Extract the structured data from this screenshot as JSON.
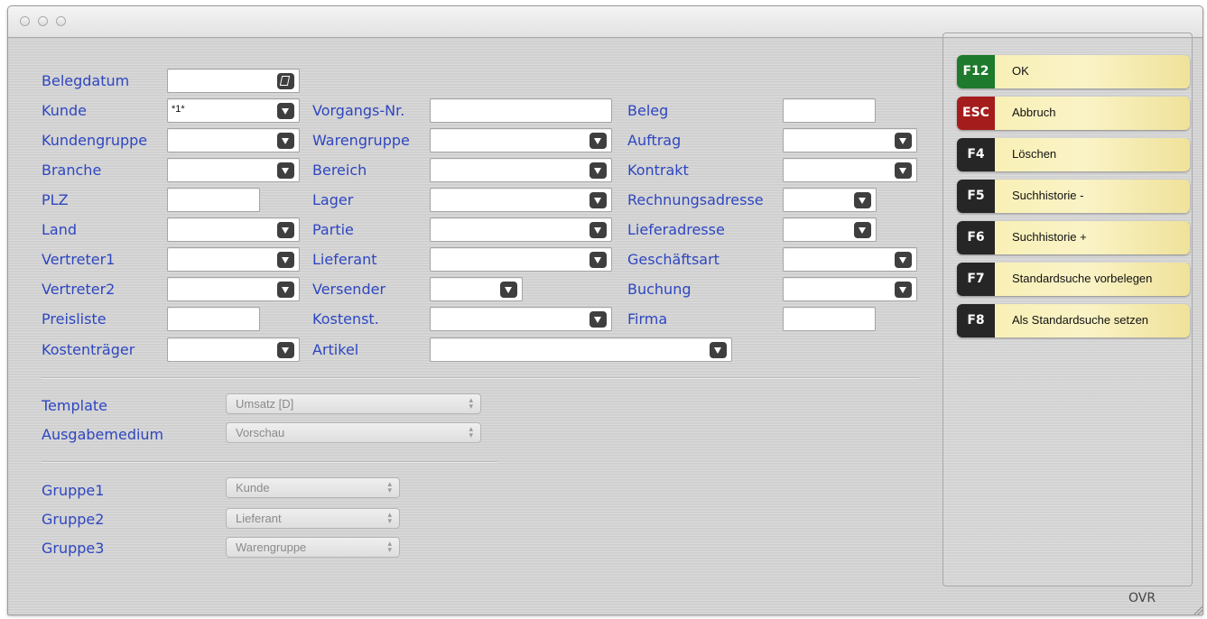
{
  "window": {
    "status": "OVR"
  },
  "filters": {
    "belegdatum": {
      "label": "Belegdatum",
      "value": ""
    },
    "kunde": {
      "label": "Kunde",
      "value": "*1*"
    },
    "kundengruppe": {
      "label": "Kundengruppe",
      "value": ""
    },
    "branche": {
      "label": "Branche",
      "value": ""
    },
    "plz": {
      "label": "PLZ",
      "value": ""
    },
    "land": {
      "label": "Land",
      "value": ""
    },
    "vertreter1": {
      "label": "Vertreter1",
      "value": ""
    },
    "vertreter2": {
      "label": "Vertreter2",
      "value": ""
    },
    "preisliste": {
      "label": "Preisliste",
      "value": ""
    },
    "kostentraeger": {
      "label": "Kostenträger",
      "value": ""
    },
    "vorgangsnr": {
      "label": "Vorgangs-Nr.",
      "value": ""
    },
    "warengruppe": {
      "label": "Warengruppe",
      "value": ""
    },
    "bereich": {
      "label": "Bereich",
      "value": ""
    },
    "lager": {
      "label": "Lager",
      "value": ""
    },
    "partie": {
      "label": "Partie",
      "value": ""
    },
    "lieferant": {
      "label": "Lieferant",
      "value": ""
    },
    "versender": {
      "label": "Versender",
      "value": ""
    },
    "kostenst": {
      "label": "Kostenst.",
      "value": ""
    },
    "artikel": {
      "label": "Artikel",
      "value": ""
    },
    "beleg": {
      "label": "Beleg",
      "value": ""
    },
    "auftrag": {
      "label": "Auftrag",
      "value": ""
    },
    "kontrakt": {
      "label": "Kontrakt",
      "value": ""
    },
    "rechnungsadresse": {
      "label": "Rechnungsadresse",
      "value": ""
    },
    "lieferadresse": {
      "label": "Lieferadresse",
      "value": ""
    },
    "geschaeftsart": {
      "label": "Geschäftsart",
      "value": ""
    },
    "buchung": {
      "label": "Buchung",
      "value": ""
    },
    "firma": {
      "label": "Firma",
      "value": ""
    }
  },
  "output": {
    "template": {
      "label": "Template",
      "value": "Umsatz [D]"
    },
    "ausgabemedium": {
      "label": "Ausgabemedium",
      "value": "Vorschau"
    }
  },
  "grouping": {
    "gruppe1": {
      "label": "Gruppe1",
      "value": "Kunde"
    },
    "gruppe2": {
      "label": "Gruppe2",
      "value": "Lieferant"
    },
    "gruppe3": {
      "label": "Gruppe3",
      "value": "Warengruppe"
    }
  },
  "actions": [
    {
      "key": "F12",
      "label": "OK",
      "key_color": "#1e7a2c"
    },
    {
      "key": "ESC",
      "label": "Abbruch",
      "key_color": "#a51c1c"
    },
    {
      "key": "F4",
      "label": "Löschen",
      "key_color": "#262626"
    },
    {
      "key": "F5",
      "label": "Suchhistorie -",
      "key_color": "#262626"
    },
    {
      "key": "F6",
      "label": "Suchhistorie +",
      "key_color": "#262626"
    },
    {
      "key": "F7",
      "label": "Standardsuche vorbelegen",
      "key_color": "#262626"
    },
    {
      "key": "F8",
      "label": "Als Standardsuche setzen",
      "key_color": "#262626"
    }
  ]
}
